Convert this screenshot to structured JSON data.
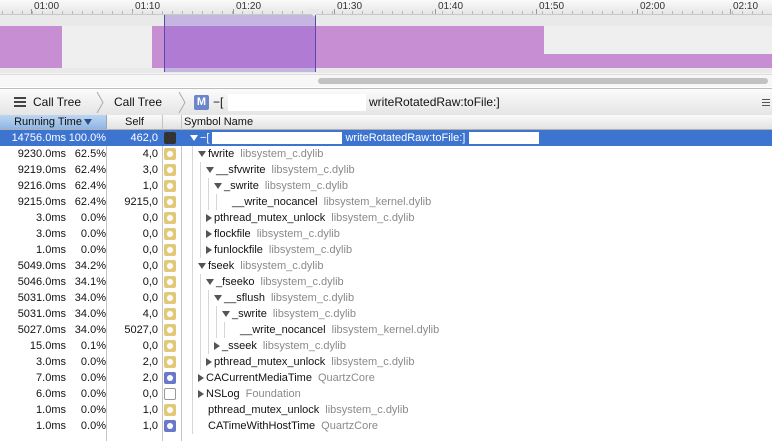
{
  "timeline": {
    "ticks": [
      "01:00",
      "01:10",
      "01:20",
      "01:30",
      "01:40",
      "01:50",
      "02:00",
      "02:10"
    ]
  },
  "jumpbar": {
    "crumb1": "Call Tree",
    "crumb2": "Call Tree",
    "method_badge": "M",
    "method_prefix": "−[",
    "method_name": "writeRotatedRaw:toFile:]"
  },
  "table": {
    "headers": {
      "running_time": "Running Time",
      "self": "Self",
      "symbol_name": "Symbol Name"
    },
    "rows": [
      {
        "ms": "14756.0ms",
        "pct": "100.0%",
        "self": "462,0",
        "icon": "user",
        "indent": 0,
        "expander": "down",
        "symbol": "−[",
        "lib": "",
        "selected": true,
        "symbol_tail": "writeRotatedRaw:toFile:]"
      },
      {
        "ms": "9230.0ms",
        "pct": "62.5%",
        "self": "4,0",
        "icon": "lib",
        "indent": 1,
        "expander": "down",
        "symbol": "fwrite",
        "lib": "libsystem_c.dylib"
      },
      {
        "ms": "9219.0ms",
        "pct": "62.4%",
        "self": "3,0",
        "icon": "lib",
        "indent": 2,
        "expander": "down",
        "symbol": "__sfvwrite",
        "lib": "libsystem_c.dylib"
      },
      {
        "ms": "9216.0ms",
        "pct": "62.4%",
        "self": "1,0",
        "icon": "lib",
        "indent": 3,
        "expander": "down",
        "symbol": "_swrite",
        "lib": "libsystem_c.dylib"
      },
      {
        "ms": "9215.0ms",
        "pct": "62.4%",
        "self": "9215,0",
        "icon": "lib",
        "indent": 4,
        "expander": "none",
        "symbol": "__write_nocancel",
        "lib": "libsystem_kernel.dylib"
      },
      {
        "ms": "3.0ms",
        "pct": "0.0%",
        "self": "0,0",
        "icon": "lib",
        "indent": 2,
        "expander": "right",
        "symbol": "pthread_mutex_unlock",
        "lib": "libsystem_c.dylib"
      },
      {
        "ms": "3.0ms",
        "pct": "0.0%",
        "self": "0,0",
        "icon": "lib",
        "indent": 2,
        "expander": "right",
        "symbol": "flockfile",
        "lib": "libsystem_c.dylib"
      },
      {
        "ms": "1.0ms",
        "pct": "0.0%",
        "self": "0,0",
        "icon": "lib",
        "indent": 2,
        "expander": "right",
        "symbol": "funlockfile",
        "lib": "libsystem_c.dylib"
      },
      {
        "ms": "5049.0ms",
        "pct": "34.2%",
        "self": "0,0",
        "icon": "lib",
        "indent": 1,
        "expander": "down",
        "symbol": "fseek",
        "lib": "libsystem_c.dylib"
      },
      {
        "ms": "5046.0ms",
        "pct": "34.1%",
        "self": "0,0",
        "icon": "lib",
        "indent": 2,
        "expander": "down",
        "symbol": "_fseeko",
        "lib": "libsystem_c.dylib"
      },
      {
        "ms": "5031.0ms",
        "pct": "34.0%",
        "self": "0,0",
        "icon": "lib",
        "indent": 3,
        "expander": "down",
        "symbol": "__sflush",
        "lib": "libsystem_c.dylib"
      },
      {
        "ms": "5031.0ms",
        "pct": "34.0%",
        "self": "4,0",
        "icon": "lib",
        "indent": 4,
        "expander": "down",
        "symbol": "_swrite",
        "lib": "libsystem_c.dylib"
      },
      {
        "ms": "5027.0ms",
        "pct": "34.0%",
        "self": "5027,0",
        "icon": "lib",
        "indent": 5,
        "expander": "none",
        "symbol": "__write_nocancel",
        "lib": "libsystem_kernel.dylib"
      },
      {
        "ms": "15.0ms",
        "pct": "0.1%",
        "self": "0,0",
        "icon": "lib",
        "indent": 3,
        "expander": "right",
        "symbol": "_sseek",
        "lib": "libsystem_c.dylib"
      },
      {
        "ms": "3.0ms",
        "pct": "0.0%",
        "self": "2,0",
        "icon": "lib",
        "indent": 2,
        "expander": "right",
        "symbol": "pthread_mutex_unlock",
        "lib": "libsystem_c.dylib"
      },
      {
        "ms": "7.0ms",
        "pct": "0.0%",
        "self": "2,0",
        "icon": "core",
        "indent": 1,
        "expander": "right",
        "symbol": "CACurrentMediaTime",
        "lib": "QuartzCore"
      },
      {
        "ms": "6.0ms",
        "pct": "0.0%",
        "self": "0,0",
        "icon": "found",
        "indent": 1,
        "expander": "right",
        "symbol": "NSLog",
        "lib": "Foundation"
      },
      {
        "ms": "1.0ms",
        "pct": "0.0%",
        "self": "1,0",
        "icon": "lib",
        "indent": 1,
        "expander": "none",
        "symbol": "pthread_mutex_unlock",
        "lib": "libsystem_c.dylib"
      },
      {
        "ms": "1.0ms",
        "pct": "0.0%",
        "self": "1,0",
        "icon": "core",
        "indent": 1,
        "expander": "none",
        "symbol": "CATimeWithHostTime",
        "lib": "QuartzCore"
      }
    ]
  }
}
